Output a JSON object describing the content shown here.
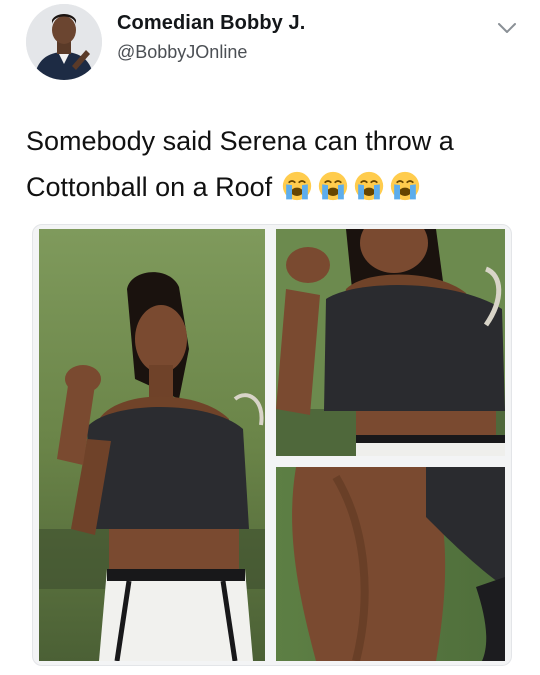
{
  "tweet": {
    "display_name": "Comedian Bobby J.",
    "handle": "@BobbyJOnline",
    "text": "Somebody said Serena can throw a Cottonball on a Roof",
    "emoji": [
      "loudly-crying-face",
      "loudly-crying-face",
      "loudly-crying-face",
      "loudly-crying-face"
    ],
    "menu_icon": "chevron-down-icon"
  },
  "media": {
    "photos": [
      {
        "name": "photo-full-pose"
      },
      {
        "name": "photo-flexed-arm"
      },
      {
        "name": "photo-calf-closeup"
      }
    ]
  },
  "colors": {
    "text": "#14171a",
    "handle": "#4b4f54",
    "border": "#e3e5e8",
    "emoji_face": "#ffcc4d",
    "emoji_tears": "#5dadec"
  }
}
